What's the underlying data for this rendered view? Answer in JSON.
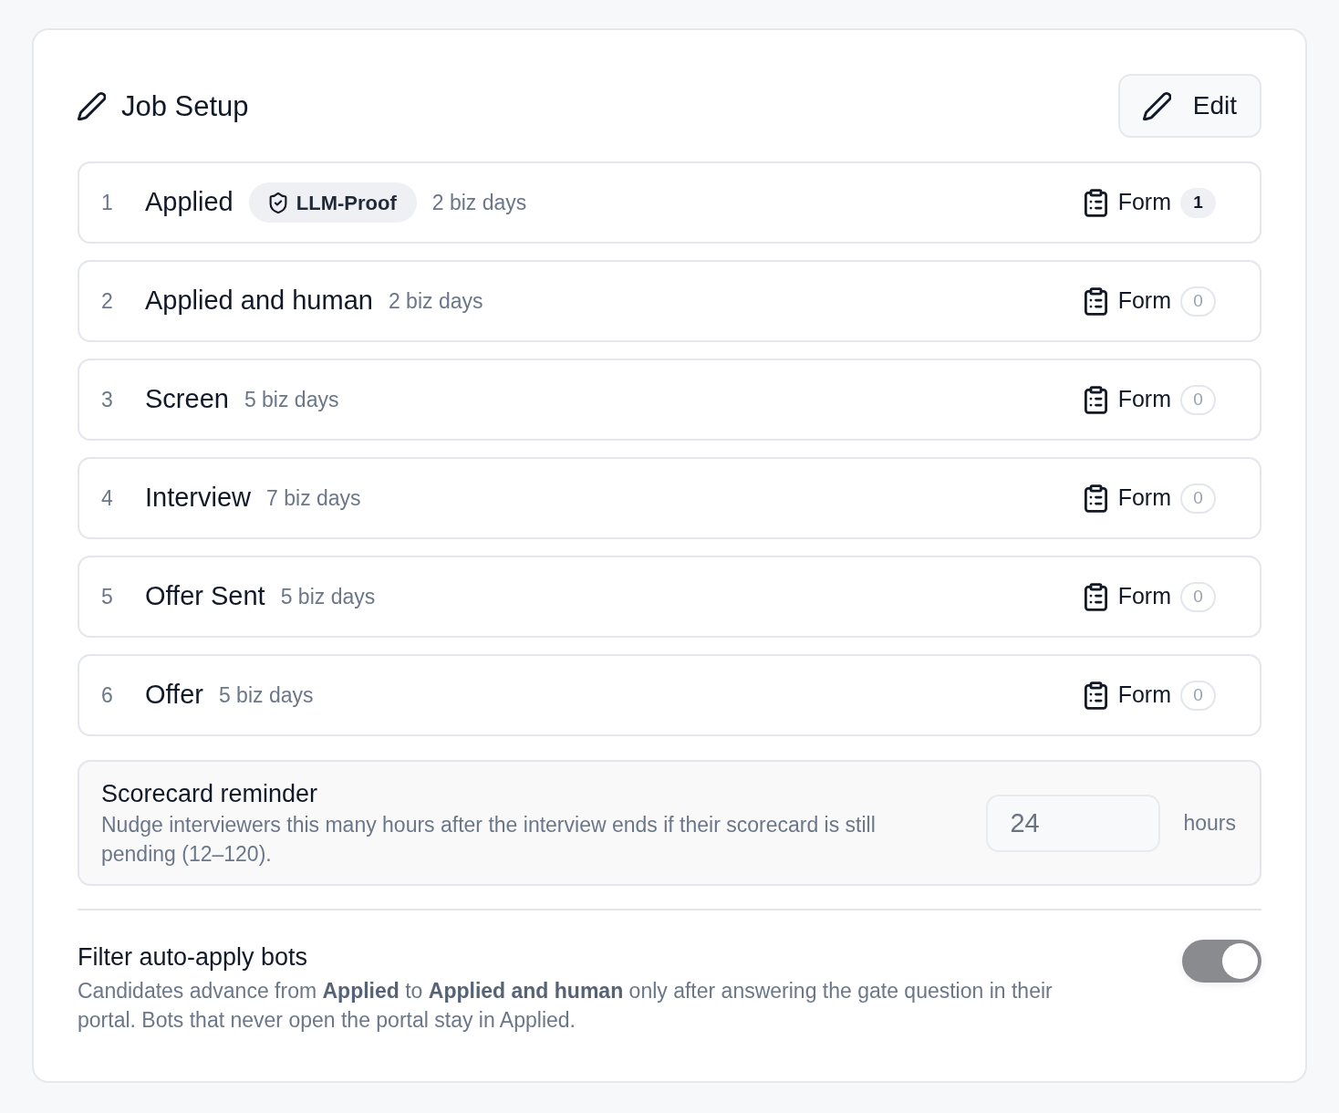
{
  "header": {
    "title": "Job Setup",
    "edit_button": "Edit"
  },
  "stages": [
    {
      "number": "1",
      "name": "Applied",
      "badge": "LLM-Proof",
      "duration": "2 biz days",
      "form_label": "Form",
      "form_count": "1",
      "form_count_filled": true
    },
    {
      "number": "2",
      "name": "Applied and human",
      "duration": "2 biz days",
      "form_label": "Form",
      "form_count": "0",
      "form_count_filled": false
    },
    {
      "number": "3",
      "name": "Screen",
      "duration": "5 biz days",
      "form_label": "Form",
      "form_count": "0",
      "form_count_filled": false
    },
    {
      "number": "4",
      "name": "Interview",
      "duration": "7 biz days",
      "form_label": "Form",
      "form_count": "0",
      "form_count_filled": false
    },
    {
      "number": "5",
      "name": "Offer Sent",
      "duration": "5 biz days",
      "form_label": "Form",
      "form_count": "0",
      "form_count_filled": false
    },
    {
      "number": "6",
      "name": "Offer",
      "duration": "5 biz days",
      "form_label": "Form",
      "form_count": "0",
      "form_count_filled": false
    }
  ],
  "scorecard_reminder": {
    "title": "Scorecard reminder",
    "description": "Nudge interviewers this many hours after the interview ends if their scorecard is still pending (12–120).",
    "value": "24",
    "unit": "hours"
  },
  "bot_filter": {
    "title": "Filter auto-apply bots",
    "description": "Candidates advance from **Applied** to **Applied and human** only after answering the gate question in their portal. Bots that never open the portal stay in Applied.",
    "on": true
  }
}
